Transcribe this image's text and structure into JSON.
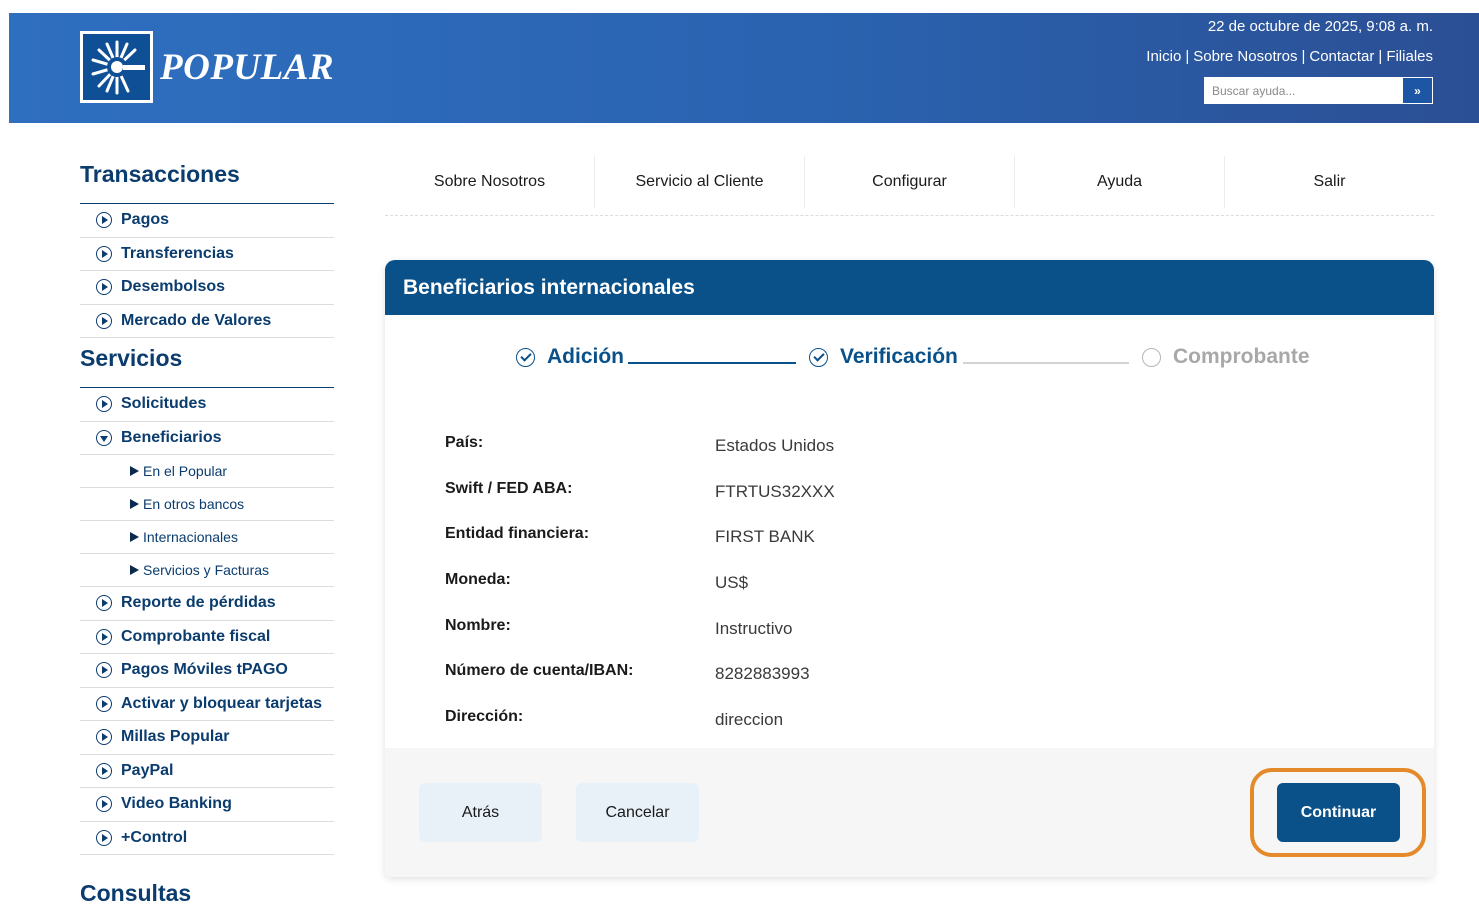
{
  "header": {
    "logo_text": "POPULAR",
    "datetime": "22 de octubre de 2025, 9:08 a. m.",
    "links": [
      "Inicio",
      "Sobre Nosotros",
      "Contactar",
      "Filiales"
    ],
    "link_separator": "|",
    "search_placeholder": "Buscar ayuda...",
    "search_button": "»"
  },
  "sidebar": {
    "sections": [
      {
        "title": "Transacciones",
        "items": [
          {
            "label": "Pagos",
            "icon": "play-circle-icon"
          },
          {
            "label": "Transferencias",
            "icon": "play-circle-icon"
          },
          {
            "label": "Desembolsos",
            "icon": "play-circle-icon"
          },
          {
            "label": "Mercado de Valores",
            "icon": "play-circle-icon"
          }
        ]
      },
      {
        "title": "Servicios",
        "items": [
          {
            "label": "Solicitudes",
            "icon": "play-circle-icon"
          },
          {
            "label": "Beneficiarios",
            "icon": "chevron-down-circle-icon",
            "expanded": true,
            "children": [
              "En el Popular",
              "En otros bancos",
              "Internacionales",
              "Servicios y Facturas"
            ]
          },
          {
            "label": "Reporte de pérdidas",
            "icon": "play-circle-icon"
          },
          {
            "label": "Comprobante fiscal",
            "icon": "play-circle-icon"
          },
          {
            "label": "Pagos Móviles tPAGO",
            "icon": "play-circle-icon"
          },
          {
            "label": "Activar y bloquear tarjetas",
            "icon": "play-circle-icon"
          },
          {
            "label": "Millas Popular",
            "icon": "play-circle-icon"
          },
          {
            "label": "PayPal",
            "icon": "play-circle-icon"
          },
          {
            "label": "Video Banking",
            "icon": "play-circle-icon"
          },
          {
            "label": "+Control",
            "icon": "play-circle-icon"
          }
        ]
      }
    ],
    "next_section": "Consultas"
  },
  "tabs": [
    "Sobre Nosotros",
    "Servicio al Cliente",
    "Configurar",
    "Ayuda",
    "Salir"
  ],
  "card": {
    "title": "Beneficiarios internacionales",
    "steps": [
      {
        "label": "Adición",
        "state": "done"
      },
      {
        "label": "Verificación",
        "state": "done"
      },
      {
        "label": "Comprobante",
        "state": "pending"
      }
    ],
    "fields": [
      {
        "label": "País:",
        "value": "Estados Unidos"
      },
      {
        "label": "Swift / FED ABA:",
        "value": "FTRTUS32XXX"
      },
      {
        "label": "Entidad financiera:",
        "value": "FIRST BANK"
      },
      {
        "label": "Moneda:",
        "value": "US$"
      },
      {
        "label": "Nombre:",
        "value": "Instructivo"
      },
      {
        "label": "Número de cuenta/IBAN:",
        "value": "8282883993"
      },
      {
        "label": "Dirección:",
        "value": "direccion"
      }
    ],
    "buttons": {
      "back": "Atrás",
      "cancel": "Cancelar",
      "continue": "Continuar"
    }
  },
  "colors": {
    "brand_blue": "#0a5089",
    "header_gradient_start": "#2f6fc0",
    "highlight_ring": "#e48a2a",
    "pending_gray": "#a8a8a8"
  }
}
